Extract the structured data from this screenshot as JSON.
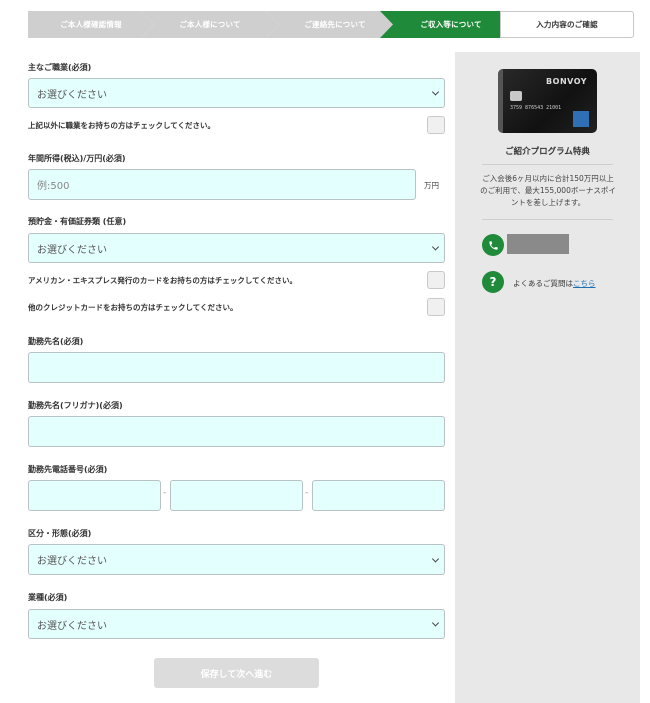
{
  "steps": [
    {
      "label": "ご本人様確認情報",
      "state": "done"
    },
    {
      "label": "ご本人様について",
      "state": "done"
    },
    {
      "label": "ご連絡先について",
      "state": "done"
    },
    {
      "label": "ご収入等について",
      "state": "current"
    },
    {
      "label": "入力内容のご確認",
      "state": "upcoming"
    }
  ],
  "form": {
    "occupation": {
      "label": "主なご職業(必須)",
      "value": "お選びください"
    },
    "other_occupation_check": {
      "label": "上記以外に職業をお持ちの方はチェックしてください。"
    },
    "income": {
      "label": "年間所得(税込)/万円(必須)",
      "placeholder": "例:500",
      "unit": "万円"
    },
    "savings": {
      "label": "預貯金・有価証券類 (任意)",
      "value": "お選びください"
    },
    "amex_card_check": {
      "label": "アメリカン・エキスプレス発行のカードをお持ちの方はチェックしてください。"
    },
    "other_card_check": {
      "label": "他のクレジットカードをお持ちの方はチェックしてください。"
    },
    "company_name": {
      "label": "勤務先名(必須)",
      "value": ""
    },
    "company_kana": {
      "label": "勤務先名(フリガナ)(必須)",
      "value": ""
    },
    "company_phone": {
      "label": "勤務先電話番号(必須)",
      "part1": "",
      "part2": "",
      "part3": "",
      "separator": "-"
    },
    "category": {
      "label": "区分・形態(必須)",
      "value": "お選びください"
    },
    "industry": {
      "label": "業種(必須)",
      "value": "お選びください"
    },
    "submit_label": "保存して次へ進む"
  },
  "sidebar": {
    "card": {
      "brand": "BONVOY",
      "number": "3759 876543 21001"
    },
    "title": "ご紹介プログラム特典",
    "description": "ご入会後6ヶ月以内に合計150万円以上のご利用で、最大155,000ボーナスポイントを差し上げます。",
    "faq_text": "よくあるご質問は",
    "faq_link": "こちら"
  },
  "colors": {
    "accent": "#1f8a3a",
    "field_bg": "#e3fffe",
    "step_gray": "#cfcfcf"
  }
}
